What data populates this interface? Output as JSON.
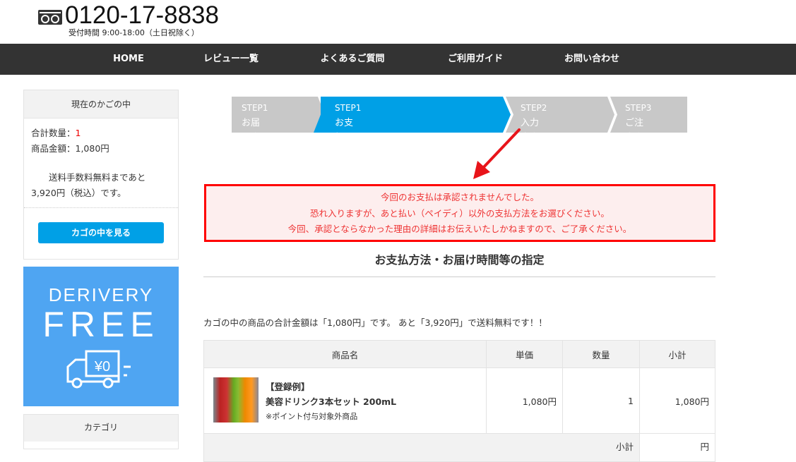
{
  "header": {
    "phone": "0120-17-8838",
    "hours": "受付時間 9:00-18:00（土日祝除く）",
    "freedial_icon": "freedial-icon"
  },
  "nav": [
    "HOME",
    "レビュー一覧",
    "よくあるご質問",
    "ご利用ガイド",
    "お問い合わせ"
  ],
  "cart": {
    "title": "現在のかごの中",
    "qty_label": "合計数量：",
    "qty": "1",
    "amount": "商品金額：1,080円",
    "free_line1": "送料手数料無料まであと",
    "free_line2": "3,920円（税込）です。",
    "button": "カゴの中を見る"
  },
  "banner": {
    "line1": "DERIVERY",
    "line2": "FREE",
    "truck_label": "¥0"
  },
  "category": {
    "title": "カテゴリ"
  },
  "steps": [
    {
      "num": "STEP1",
      "label": "お届け先の指定",
      "active": false
    },
    {
      "num": "STEP1",
      "label": "お支払い方法・お届け時間帯の指定",
      "active": true
    },
    {
      "num": "STEP2",
      "label": "入力内容のご確認",
      "active": false
    },
    {
      "num": "STEP3",
      "label": "ご注文完了",
      "active": false
    }
  ],
  "error": [
    "今回のお支払は承認されませんでした。",
    "恐れ入りますが、あと払い（ペイディ）以外の支払方法をお選びください。",
    "今回、承認とならなかった理由の詳細はお伝えいたしかねますので、ご了承ください。"
  ],
  "page_title": "お支払方法・お届け時間等の指定",
  "summary": "カゴの中の商品の合計金額は「1,080円」です。 あと「3,920円」で送料無料です！！",
  "table": {
    "headers": [
      "商品名",
      "単価",
      "数量",
      "小計"
    ],
    "rows": [
      {
        "tag": "【登録例】",
        "name": "美容ドリンク3本セット 200mL",
        "note": "※ポイント付与対象外商品",
        "price": "1,080円",
        "qty": "1",
        "subtotal": "1,080円"
      }
    ],
    "footer_label": "小計",
    "footer_value": "円"
  },
  "colors": {
    "accent": "#00a0e6",
    "nav": "#333333",
    "error": "#ff0000",
    "step_inactive": "#c8c8c8"
  }
}
